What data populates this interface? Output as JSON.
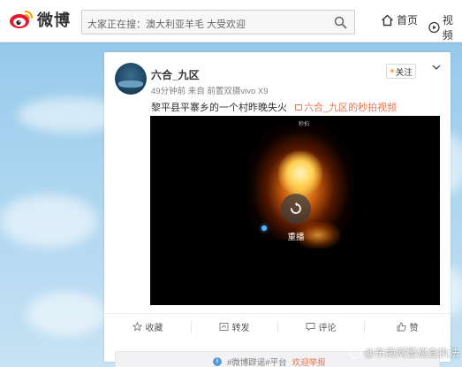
{
  "header": {
    "logo_text": "微博",
    "search_placeholder": "大家正在搜：澳大利亚羊毛 大受欢迎",
    "nav": [
      {
        "label": "首页",
        "icon": "home-icon"
      },
      {
        "label": "视频",
        "icon": "video-icon"
      }
    ]
  },
  "post": {
    "username": "六合_九区",
    "meta": "49分钟前 来自 前置双摄vivo X9",
    "follow_label": "关注",
    "text": "黎平县平寨乡的一个村昨晚失火",
    "video_link": "六合_九区的秒拍视频",
    "video": {
      "replay_label": "重播",
      "badge": "秒拍"
    },
    "actions": [
      {
        "label": "收藏",
        "icon": "star-icon"
      },
      {
        "label": "转发",
        "icon": "repost-icon"
      },
      {
        "label": "评论",
        "icon": "comment-icon"
      },
      {
        "label": "赞",
        "icon": "thumb-up-icon"
      }
    ],
    "comment_notice": "#微博辟谣#平台",
    "comment_link": "欢迎举报"
  },
  "watermark": "@东南网警巡查执法",
  "colors": {
    "accent": "#ff8200",
    "link": "#eb7350",
    "logo_red": "#e6162d"
  }
}
